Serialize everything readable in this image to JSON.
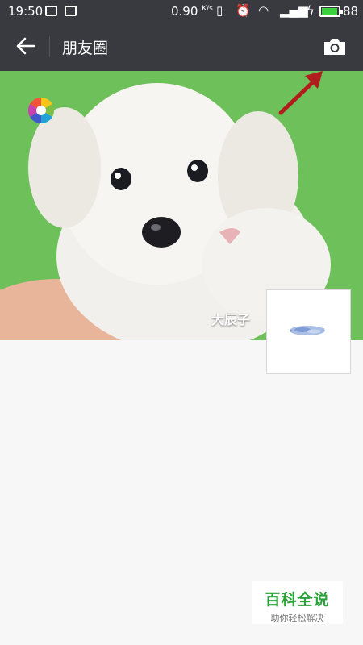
{
  "status_bar": {
    "time": "19:50",
    "network_speed": "0.90",
    "network_unit": "K/s",
    "battery_level": "88"
  },
  "nav": {
    "title": "朋友圈"
  },
  "profile": {
    "username": "大辰子"
  },
  "watermark": {
    "title": "百科全说",
    "subtitle": "助你轻松解决"
  },
  "colors": {
    "nav_background": "#393a3f",
    "cover_background": "#6ec05a",
    "page_background": "#f7f7f7",
    "watermark_green": "#2aa23a",
    "battery_green": "#3dd13d",
    "annotation_arrow": "#b11d1d"
  }
}
